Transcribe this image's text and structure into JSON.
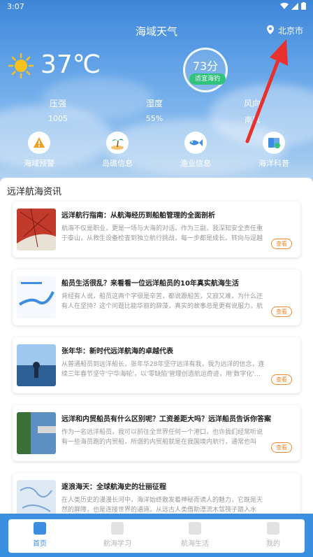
{
  "status_bar": {
    "time": "3:07"
  },
  "header": {
    "title": "海域天气",
    "location": "北京市"
  },
  "weather": {
    "temperature": "37℃",
    "score": "73分",
    "score_tag": "适宜海钓",
    "stats": [
      {
        "label": "压强",
        "value": "1005"
      },
      {
        "label": "湿度",
        "value": "55%"
      },
      {
        "label": "风向",
        "value": "南风"
      }
    ]
  },
  "shortcuts": [
    {
      "label": "海域预警",
      "icon": "warning-icon"
    },
    {
      "label": "岛礁信息",
      "icon": "island-icon"
    },
    {
      "label": "渔业信息",
      "icon": "fish-icon"
    },
    {
      "label": "海洋科普",
      "icon": "book-icon"
    }
  ],
  "news": {
    "section_title": "远洋航海资讯",
    "button_label": "查看",
    "items": [
      {
        "title": "远洋航行指南：从航海经历到船舶管理的全面剖析",
        "desc": "航海不仅是职业，更是一场与大海的对话。作为三副，我深知安全责任重于泰山，从救生设备检查到独立航行挑战，每一步都是成长。转向与逗越的智…"
      },
      {
        "title": "船员生活很乱？来看看一位远洋船员的10年真实航海生活",
        "desc": "背经有人说，船员这两个字很是辛苦，都说跟船苦，又寂又难，为什么还有人在坚持？这个问题比能华丽的辞藻，真实的故事总是更有说服力，航运…"
      },
      {
        "title": "张年华：新时代远洋航海的卓越代表",
        "desc": "从普通船员到远洋船长，张年华28年坚守远洋有我，我为远洋的信念，连续三年春节坚守'宁华海轮'，以'零缺陷'管理创造航运奇迹，用'数字化'…"
      },
      {
        "title": "远洋和内贸船员有什么区别呢？工资差距大吗？远洋船员告诉你答案",
        "desc": "作为一名远洋船员，我可以前往全世界任何一个港口，也许我们经常听说有一些海员跑的内贸船，所谓的内贸船就是在我国境内航行，通常也叫做'沿…"
      },
      {
        "title": "逐浪海天：全球航海史的壮丽征程",
        "desc": "在人类历史的漫漫长河中，海洋始终散发着神秘而诱人的魅力，它既是天然的屏障，也是连接世界的通道。从远古人类借助漂流木驾筏子踏入水域，到…"
      }
    ]
  },
  "tabs": [
    {
      "label": "首页",
      "active": true
    },
    {
      "label": "航海学习",
      "active": false
    },
    {
      "label": "航海生活",
      "active": false
    },
    {
      "label": "我的",
      "active": false
    }
  ],
  "colors": {
    "accent": "#3d8de0",
    "score_tag": "#31c27c",
    "button": "#f0892f",
    "arrow": "#e8302c"
  }
}
